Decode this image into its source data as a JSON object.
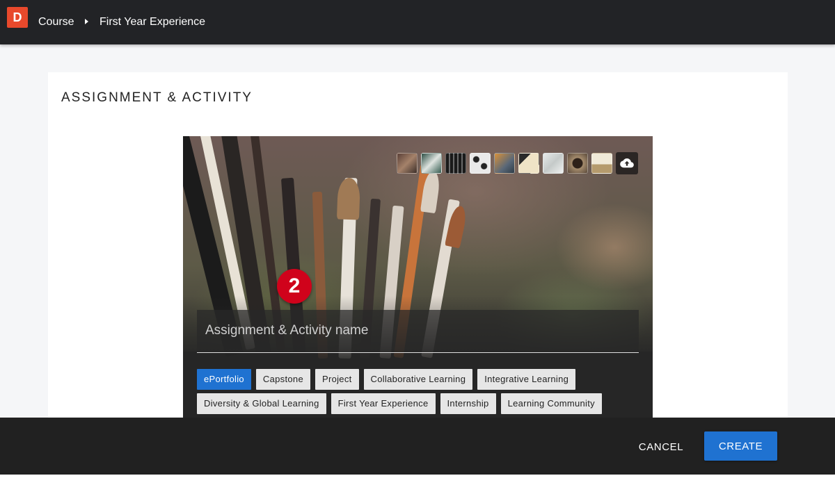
{
  "app": {
    "logo_letter": "D"
  },
  "breadcrumb": {
    "items": [
      "Course",
      "First Year Experience"
    ]
  },
  "card": {
    "title": "ASSIGNMENT & ACTIVITY"
  },
  "hero": {
    "thumbnails": [
      {
        "name": "paintbrushes-thumb",
        "color": "#7a5a50"
      },
      {
        "name": "desk-thumb",
        "color": "#3f6a5a"
      },
      {
        "name": "typewriter-thumb",
        "color": "#2b2b2b"
      },
      {
        "name": "pattern-thumb",
        "color": "#d8d8d8"
      },
      {
        "name": "sunset-thumb",
        "color": "#c8813a"
      },
      {
        "name": "notebook-thumb",
        "color": "#e6d9bf"
      },
      {
        "name": "marble-thumb",
        "color": "#d9dcdc"
      },
      {
        "name": "coffee-thumb",
        "color": "#7d6a55"
      },
      {
        "name": "workspace-thumb",
        "color": "#d4c7a6"
      }
    ],
    "upload_icon": "cloud-upload-icon",
    "step_badge": "2",
    "name_placeholder": "Assignment & Activity name"
  },
  "tags": {
    "rows": [
      [
        "ePortfolio",
        "Capstone",
        "Project",
        "Collaborative Learning",
        "Integrative Learning"
      ],
      [
        "Diversity & Global Learning",
        "First Year Experience",
        "Internship",
        "Learning Community"
      ]
    ],
    "active": "ePortfolio"
  },
  "footer": {
    "cancel_label": "CANCEL",
    "create_label": "CREATE"
  },
  "colors": {
    "accent": "#1f72d1",
    "badge": "#d0021b",
    "logo": "#e8492c"
  }
}
